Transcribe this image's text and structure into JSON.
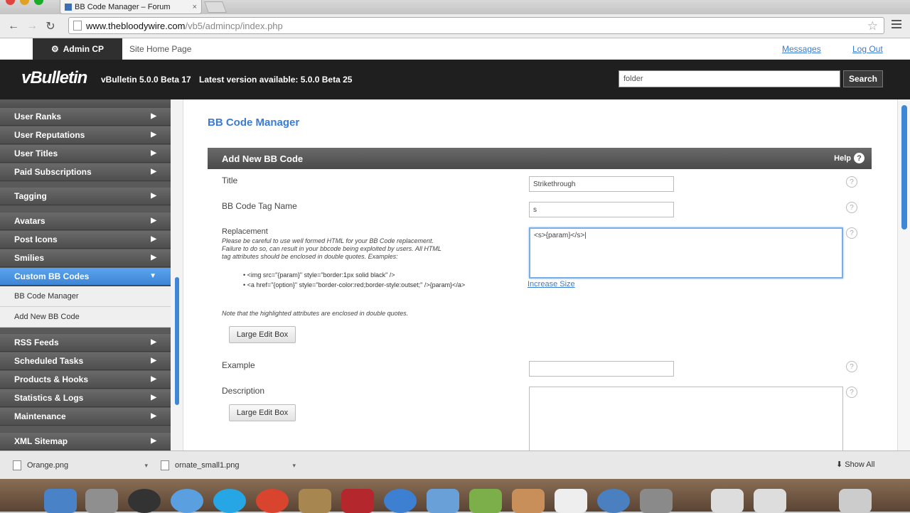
{
  "browser": {
    "tab_title": "BB Code Manager – Forum",
    "tab_close": "×",
    "url_host": "www.thebloodywire.com",
    "url_path": "/vb5/admincp/index.php",
    "back": "←",
    "forward": "→",
    "reload": "↻",
    "star": "☆"
  },
  "topnav": {
    "admincp_icon": "⚙",
    "admincp_label": "Admin CP",
    "site_home": "Site Home Page",
    "messages": "Messages",
    "logout": "Log Out"
  },
  "header": {
    "logo": "vBulletin",
    "version": "vBulletin 5.0.0 Beta 17",
    "latest": "Latest version available: 5.0.0 Beta 25",
    "search_value": "folder",
    "search_button": "Search"
  },
  "sidebar": {
    "items": [
      {
        "label": "User Ranks"
      },
      {
        "label": "User Reputations"
      },
      {
        "label": "User Titles"
      },
      {
        "label": "Paid Subscriptions"
      },
      {
        "label": "Tagging"
      },
      {
        "label": "Avatars"
      },
      {
        "label": "Post Icons"
      },
      {
        "label": "Smilies"
      },
      {
        "label": "Custom BB Codes"
      },
      {
        "label": "RSS Feeds"
      },
      {
        "label": "Scheduled Tasks"
      },
      {
        "label": "Products & Hooks"
      },
      {
        "label": "Statistics & Logs"
      },
      {
        "label": "Maintenance"
      },
      {
        "label": "XML Sitemap"
      }
    ],
    "sub_items": [
      {
        "label": "BB Code Manager"
      },
      {
        "label": "Add New BB Code"
      }
    ],
    "arrow": "▶",
    "arrow_down": "▼"
  },
  "main": {
    "page_title": "BB Code Manager",
    "form_title": "Add New BB Code",
    "help": "Help",
    "help_icon": "?",
    "fields": {
      "title_label": "Title",
      "title_value": "Strikethrough",
      "tag_label": "BB Code Tag Name",
      "tag_value": "s",
      "replacement_label": "Replacement",
      "replacement_value": "<s>{param}</s>|",
      "replacement_note_1": "Please be careful to use well formed HTML for your BB Code replacement.",
      "replacement_note_2": "Failure to do so, can result in your bbcode being exploited by users. All HTML",
      "replacement_note_3": "tag attributes should be enclosed in double quotes. Examples:",
      "example_code_1": "<img src=\"{param}\" style=\"border:1px solid black\" />",
      "example_code_2": "<a href=\"{option}\" style=\"border-color:red;border-style:outset;\" />{param}</a>",
      "highlight_note": "Note that the highlighted attributes are enclosed in double quotes.",
      "large_edit_box": "Large Edit Box",
      "increase_size": "Increase Size",
      "example_label": "Example",
      "example_value": "",
      "description_label": "Description",
      "description_value": ""
    }
  },
  "downloads": {
    "file1": "Orange.png",
    "file2": "ornate_small1.png",
    "caret": "▾",
    "show_all": "Show All",
    "show_all_icon": "⬇"
  },
  "colors": {
    "accent": "#3a7bd5",
    "sidebar_active": "#4a93e2",
    "header_bg": "#1f1f1f"
  }
}
